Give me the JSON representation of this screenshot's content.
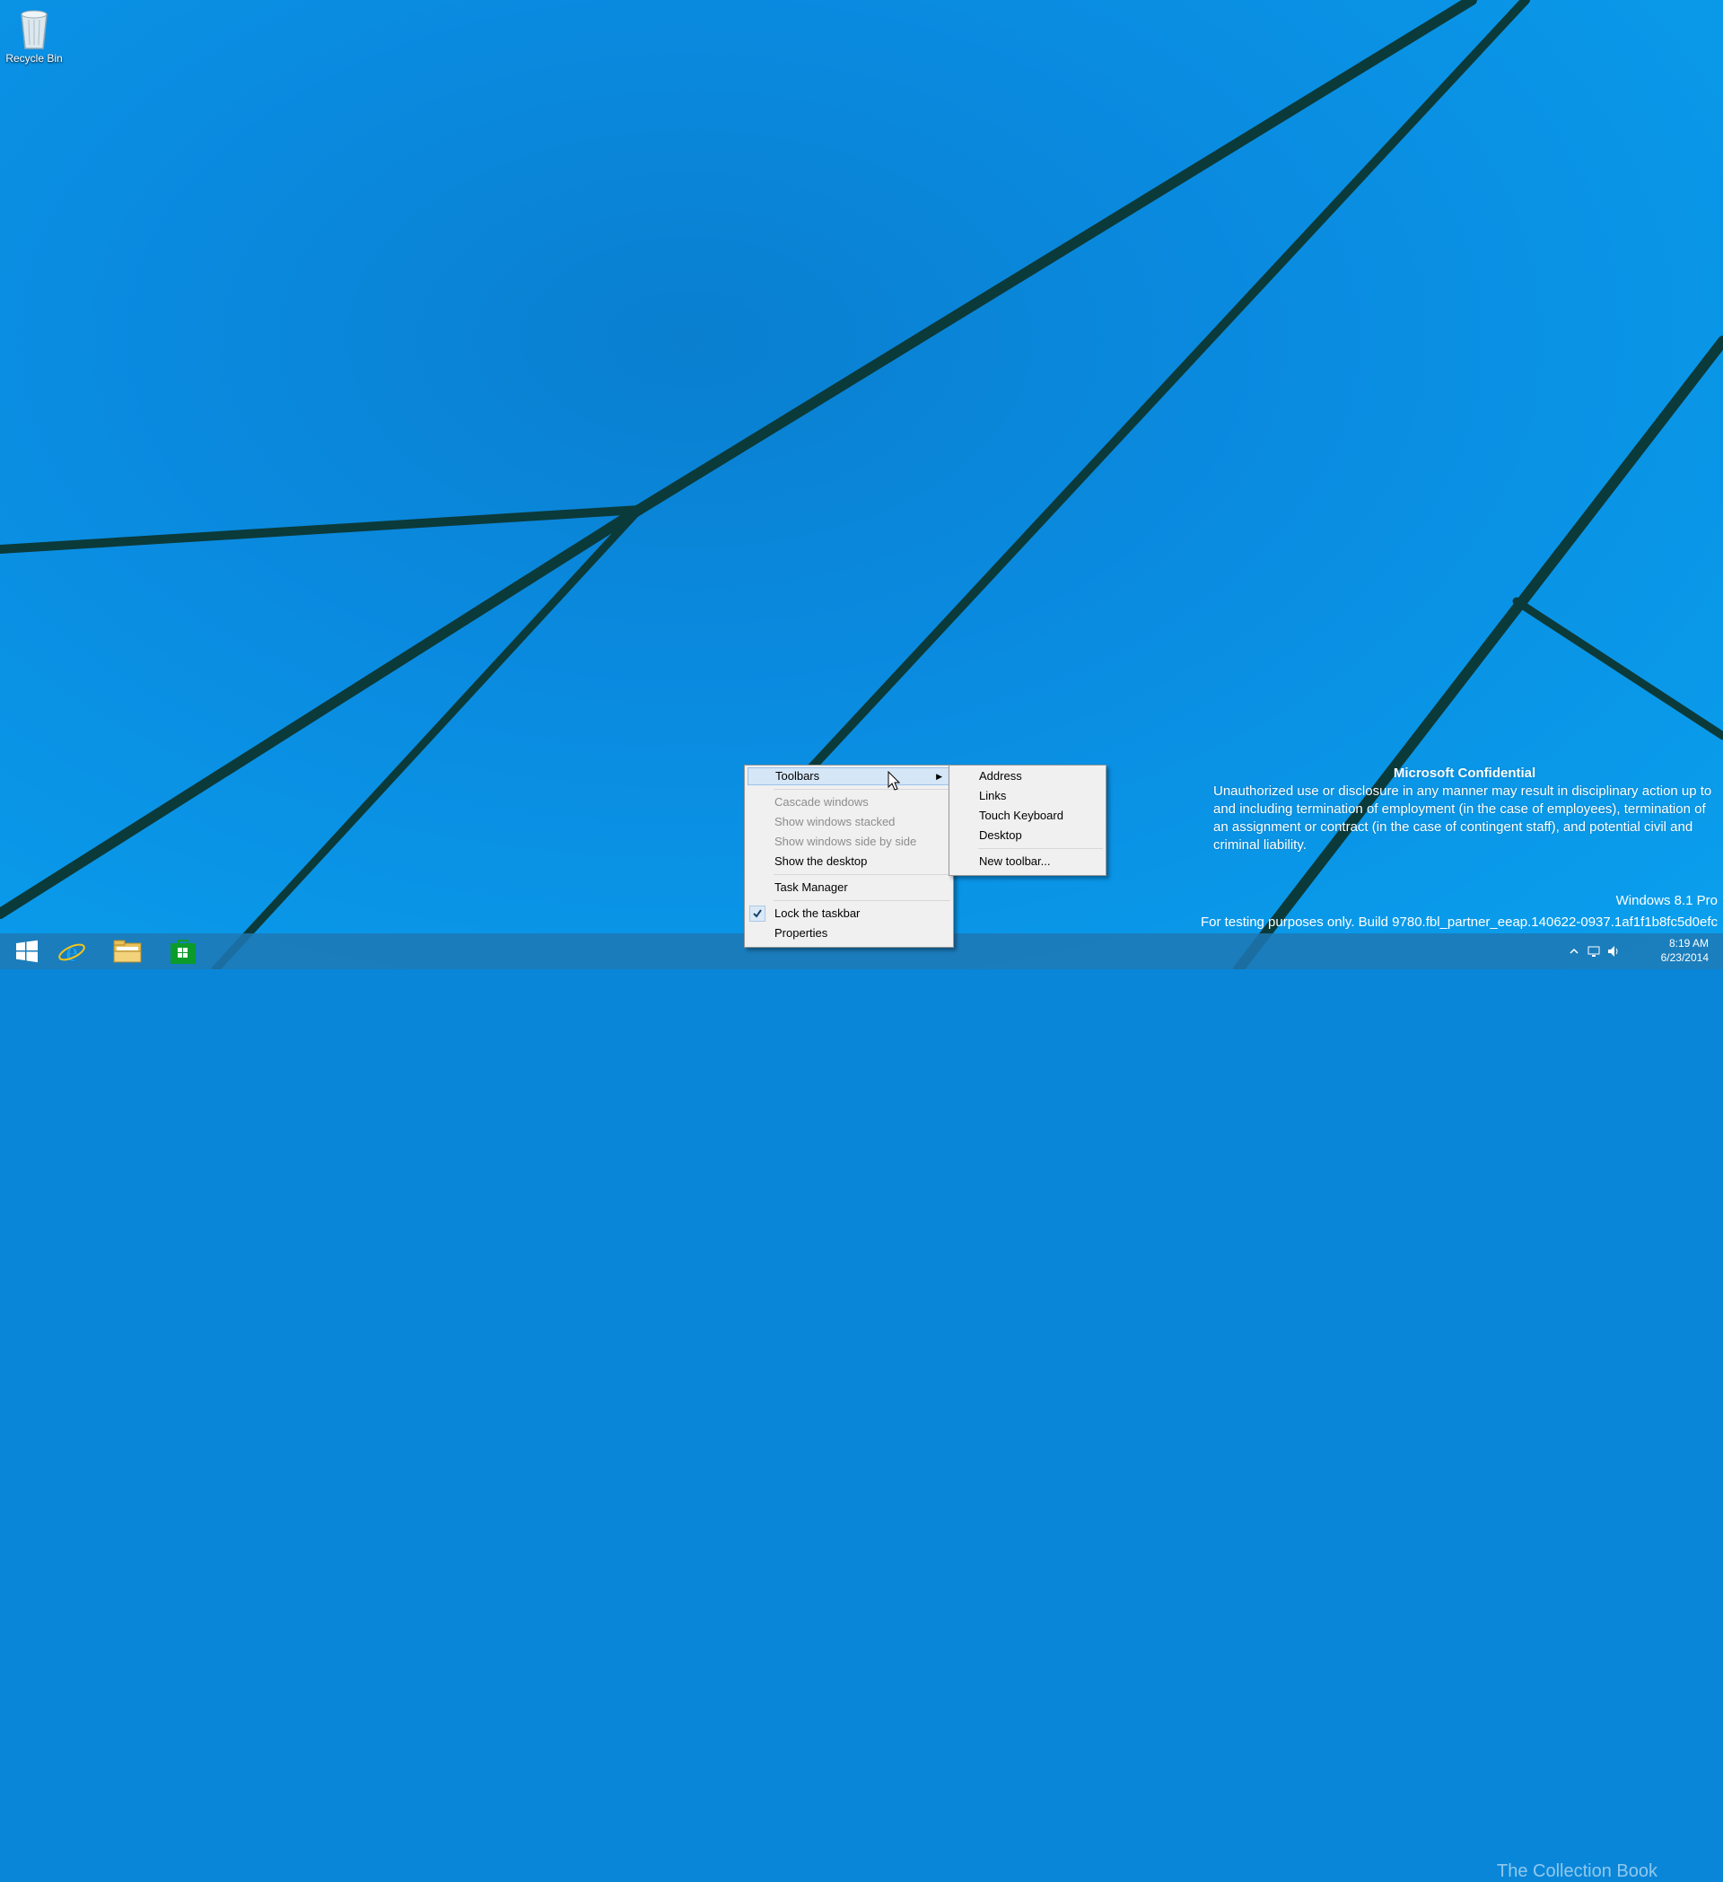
{
  "desktop": {
    "icons": [
      {
        "label": "Recycle Bin",
        "icon": "recycle-bin-icon"
      }
    ]
  },
  "taskbar": {
    "pinned": [
      {
        "name": "start",
        "icon": "windows-logo-icon"
      },
      {
        "name": "internet-explorer",
        "icon": "internet-explorer-icon"
      },
      {
        "name": "file-explorer",
        "icon": "folder-icon"
      },
      {
        "name": "store",
        "icon": "store-bag-icon"
      }
    ],
    "tray": {
      "time": "8:19 AM",
      "date": "6/23/2014"
    }
  },
  "context_menu": {
    "items": [
      {
        "label": "Toolbars",
        "state": "hover",
        "has_submenu": true
      },
      {
        "label": "Cascade windows",
        "state": "disabled"
      },
      {
        "label": "Show windows stacked",
        "state": "disabled"
      },
      {
        "label": "Show windows side by side",
        "state": "disabled"
      },
      {
        "label": "Show the desktop",
        "state": "normal"
      },
      {
        "label": "Task Manager",
        "state": "normal"
      },
      {
        "label": "Lock the taskbar",
        "state": "checked"
      },
      {
        "label": "Properties",
        "state": "normal"
      }
    ]
  },
  "toolbars_submenu": {
    "items": [
      {
        "label": "Address"
      },
      {
        "label": "Links"
      },
      {
        "label": "Touch Keyboard"
      },
      {
        "label": "Desktop"
      },
      {
        "label": "New toolbar..."
      }
    ]
  },
  "watermark": {
    "title": "Microsoft Confidential",
    "body": "Unauthorized use or disclosure in any manner may result in disciplinary action up to and including termination of employment (in the case of employees), termination of an assignment or contract (in the case of contingent staff), and potential civil and criminal liability.",
    "edition": "Windows 8.1 Pro",
    "build": "For testing purposes only. Build 9780.fbl_partner_eeap.140622-0937.1af1f1b8fc5d0efc"
  },
  "overlay_brand": "The Collection Book",
  "colors": {
    "desktop_bg": "#0a8be0",
    "wallpaper_line": "#0b3a3a",
    "taskbar": "#1e78b4",
    "menu_bg": "#f0f0f0",
    "menu_hover": "#d5e6f7"
  }
}
